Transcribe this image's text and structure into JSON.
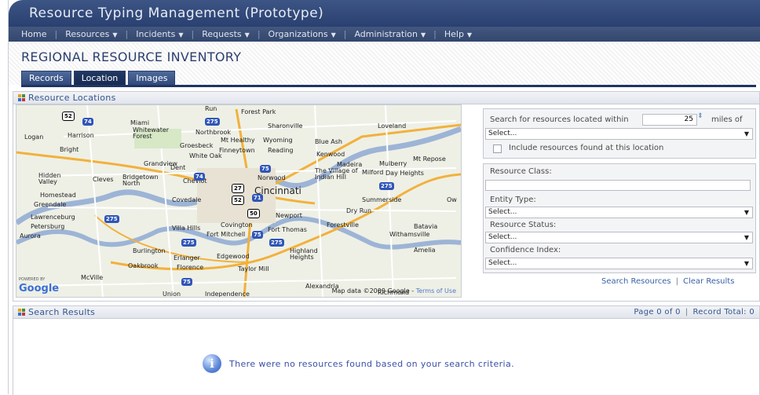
{
  "app": {
    "title": "Resource Typing Management (Prototype)"
  },
  "menu": {
    "items": [
      "Home",
      "Resources",
      "Incidents",
      "Requests",
      "Organizations",
      "Administration",
      "Help"
    ],
    "has_caret": [
      false,
      true,
      true,
      true,
      true,
      true,
      true
    ]
  },
  "page": {
    "title": "REGIONAL RESOURCE INVENTORY"
  },
  "tabs": [
    {
      "label": "Records",
      "active": false
    },
    {
      "label": "Location",
      "active": true
    },
    {
      "label": "Images",
      "active": false
    }
  ],
  "locations_panel": {
    "title": "Resource Locations"
  },
  "map": {
    "places": [
      "Forest Park",
      "Run",
      "Sharonville",
      "Loveland",
      "Logan",
      "Harrison",
      "Miami",
      "Whitewater Forest",
      "Northbrook",
      "Mt Healthy",
      "Wyoming",
      "Blue Ash",
      "Bright",
      "Groesbeck",
      "Finneytown",
      "Reading",
      "Kenwood",
      "White Oak",
      "Madeira",
      "Mulberry",
      "Mt Repose",
      "Grandview",
      "Dent",
      "The Village of Indian Hill",
      "Milford",
      "Day Heights",
      "Hidden Valley",
      "Cleves",
      "Bridgetown North",
      "Cheviot",
      "Norwood",
      "Cincinnati",
      "Homestead",
      "Greendale",
      "Covedale",
      "Summerside",
      "Lawrenceburg",
      "Newport",
      "Dry Run",
      "Petersburg",
      "Villa Hills",
      "Covington",
      "Fort Thomas",
      "Forestville",
      "Batavia",
      "Aurora",
      "Fort Mitchell",
      "Withamsville",
      "Burlington",
      "Erlanger",
      "Edgewood",
      "Highland Heights",
      "Amelia",
      "Oakbrook",
      "Florence",
      "Taylor Mill",
      "McVille",
      "Union",
      "Independence",
      "Alexandria",
      "Richmond",
      "Ow"
    ],
    "shields": [
      "52",
      "74",
      "275",
      "75",
      "74",
      "27",
      "52",
      "71",
      "50",
      "275",
      "275",
      "75",
      "275",
      "275",
      "75"
    ],
    "footer": "Map data ©2009 Google",
    "terms": "Terms of Use",
    "powered": "POWERED BY",
    "logo": "Google"
  },
  "search": {
    "within_label": "Search for resources located within",
    "miles_value": "25",
    "miles_label": "miles of",
    "location_select": "Select...",
    "include_label": "Include resources found at this location",
    "resource_class_label": "Resource Class:",
    "entity_type_label": "Entity Type:",
    "entity_type_value": "Select...",
    "resource_status_label": "Resource Status:",
    "resource_status_value": "Select...",
    "confidence_label": "Confidence Index:",
    "confidence_value": "Select...",
    "search_link": "Search Resources",
    "clear_link": "Clear Results"
  },
  "results": {
    "title": "Search Results",
    "page_text": "Page 0 of 0",
    "record_total": "Record Total: 0",
    "empty_message": "There were no resources found based on your search criteria."
  },
  "colors": {
    "accent": "#2b3f6e",
    "link": "#3a63a6",
    "panel_header": "#33558e"
  }
}
